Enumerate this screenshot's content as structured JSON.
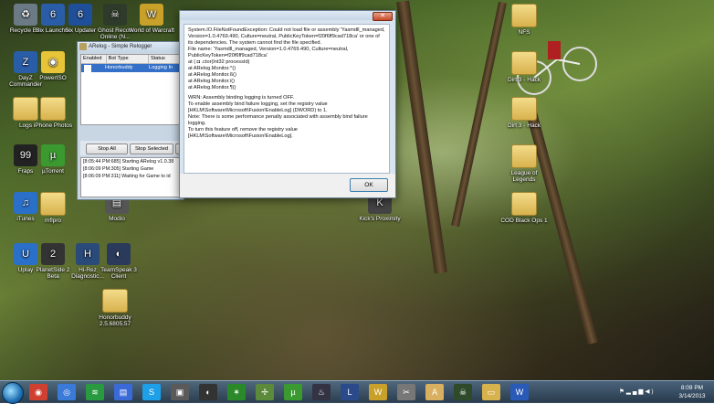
{
  "desktop_icons": [
    {
      "label": "Recycle Bin",
      "icon": "recycle-bin-icon",
      "color": "#6c7a86"
    },
    {
      "label": "Six Launcher",
      "icon": "six-launcher-icon",
      "color": "#2a5da8"
    },
    {
      "label": "Six Updater",
      "icon": "six-updater-icon",
      "color": "#1f4f98"
    },
    {
      "label": "Ghost Recon Online (N...",
      "icon": "ghost-recon-icon",
      "color": "#2e3a2a"
    },
    {
      "label": "World of Warcraft",
      "icon": "wow-icon",
      "color": "#c8a02a"
    },
    {
      "label": "DayZ Commander",
      "icon": "dayz-icon",
      "color": "#2a5da8"
    },
    {
      "label": "PowerISO",
      "icon": "poweriso-icon",
      "color": "#e8c438"
    },
    {
      "label": "Logs",
      "icon": "folder-icon",
      "color": "#e0c060"
    },
    {
      "label": "iPhone Photos",
      "icon": "folder-icon",
      "color": "#e0c060"
    },
    {
      "label": "Fraps",
      "icon": "fraps-icon",
      "color": "#222222"
    },
    {
      "label": "µTorrent",
      "icon": "utorrent-icon",
      "color": "#3a9a30"
    },
    {
      "label": "iTunes",
      "icon": "itunes-icon",
      "color": "#2a6fc8"
    },
    {
      "label": "mflpro",
      "icon": "folder-icon",
      "color": "#e0c060"
    },
    {
      "label": "Modio",
      "icon": "modio-icon",
      "color": "#555555"
    },
    {
      "label": "Uplay",
      "icon": "uplay-icon",
      "color": "#2a6fc8"
    },
    {
      "label": "PlanetSide 2 Beta",
      "icon": "planetside-icon",
      "color": "#333333"
    },
    {
      "label": "Hi-Rez Diagnostic...",
      "icon": "hirez-icon",
      "color": "#2a4a7a"
    },
    {
      "label": "TeamSpeak 3 Client",
      "icon": "teamspeak-icon",
      "color": "#2a3a5a"
    },
    {
      "label": "Honorbuddy 2.5.6805.57",
      "icon": "folder-icon",
      "color": "#e0c060"
    },
    {
      "label": "NFS",
      "icon": "folder-icon",
      "color": "#e0c060"
    },
    {
      "label": "Dirt 3 - Hack",
      "icon": "folder-icon",
      "color": "#e0c060"
    },
    {
      "label": "Dirt 3 - Hack",
      "icon": "folder-icon",
      "color": "#e0c060"
    },
    {
      "label": "League of Legends",
      "icon": "folder-icon",
      "color": "#e0c060"
    },
    {
      "label": "COD Black Ops 1",
      "icon": "folder-icon",
      "color": "#e0c060"
    },
    {
      "label": "Kick's Proximity",
      "icon": "kick-icon",
      "color": "#444444"
    }
  ],
  "error_dialog": {
    "close_label": "✕",
    "message": "System.IO.FileNotFoundException: Could not load file or assembly 'Yasmdll_managed, Version=1.0.4769.490, Culture=neutral, PublicKeyToken=f20f6ff9cad718ca' or one of its dependencies. The system cannot find the file specified.\nFile name: 'Yasmdll_managed, Version=1.0.4769.490, Culture=neutral, PublicKeyToken=f20f6ff9cad718ca'\n   at ( ◘ .ctor(Int32 processId)\n   at ARelog.Monitor.^()\n   at ARelog.Monitor.ß()\n   at ARelog.Monitor.ï()\n   at ARelog.Monitor.¶()",
    "warning": "WRN: Assembly binding logging is turned OFF.\nTo enable assembly bind failure logging, set the registry value [HKLM\\Software\\Microsoft\\Fusion!EnableLog] (DWORD) to 1.\nNote: There is some performance penalty associated with assembly bind failure logging.\nTo turn this feature off, remove the registry value [HKLM\\Software\\Microsoft\\Fusion!EnableLog].",
    "ok_label": "OK"
  },
  "arelog": {
    "title": "ARelog - Simple Relogger",
    "columns": [
      "Enabled",
      "Bot Type",
      "Status"
    ],
    "row": {
      "bot_type": "Honorbuddy",
      "status": "Logging In"
    },
    "stop_all": "Stop All",
    "stop_selected": "Stop Selected",
    "log_lines": [
      "[8:05:44 PM:685] Starting ARelog v1.0.38",
      "[8:06:09 PM:305] Starting Game",
      "[8:06:09 PM:311] Waiting for Game to id"
    ]
  },
  "taskbar": {
    "apps": [
      {
        "name": "chrome-icon",
        "color": "#d04030",
        "glyph": "◉"
      },
      {
        "name": "launcher-icon",
        "color": "#3a7ad8",
        "glyph": "◎"
      },
      {
        "name": "spotify-icon",
        "color": "#2a9a40",
        "glyph": "≋"
      },
      {
        "name": "windows-explorer-icon",
        "color": "#3a6ad8",
        "glyph": "▤"
      },
      {
        "name": "skype-icon",
        "color": "#1ea0e8",
        "glyph": "S"
      },
      {
        "name": "app-icon",
        "color": "#5a5a5a",
        "glyph": "▣"
      },
      {
        "name": "origin-icon",
        "color": "#333333",
        "glyph": "◐"
      },
      {
        "name": "razer-icon",
        "color": "#2a8a2a",
        "glyph": "✶"
      },
      {
        "name": "network-icon",
        "color": "#5a8a3a",
        "glyph": "✢"
      },
      {
        "name": "utorrent-taskbar-icon",
        "color": "#3a9a30",
        "glyph": "µ"
      },
      {
        "name": "steam-icon",
        "color": "#333344",
        "glyph": "♨"
      },
      {
        "name": "league-icon",
        "color": "#2a4a8a",
        "glyph": "L"
      },
      {
        "name": "wow-taskbar-icon",
        "color": "#c8a02a",
        "glyph": "W"
      },
      {
        "name": "tools-icon",
        "color": "#777777",
        "glyph": "✂"
      },
      {
        "name": "arelog-taskbar-icon",
        "color": "#d8b060",
        "glyph": "A"
      },
      {
        "name": "ghost-taskbar-icon",
        "color": "#2e4a2a",
        "glyph": "☠"
      },
      {
        "name": "explorer-folder-icon",
        "color": "#d8b24d",
        "glyph": "▭"
      },
      {
        "name": "word-icon",
        "color": "#2a5ab8",
        "glyph": "W"
      }
    ],
    "time": "8:09 PM",
    "date": "3/14/2013"
  }
}
